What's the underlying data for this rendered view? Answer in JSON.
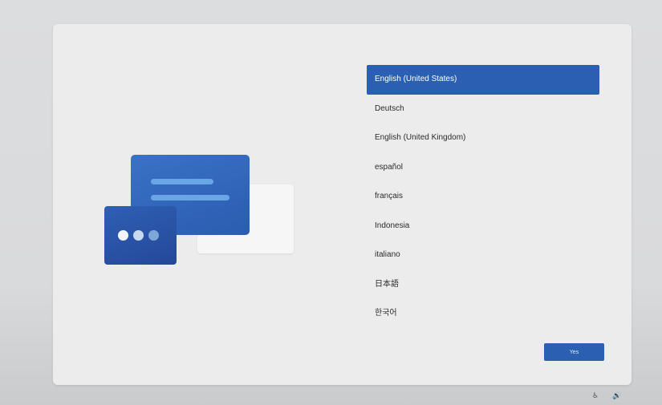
{
  "languages": [
    {
      "label": "English (United States)",
      "selected": true
    },
    {
      "label": "Deutsch",
      "selected": false
    },
    {
      "label": "English (United Kingdom)",
      "selected": false
    },
    {
      "label": "español",
      "selected": false
    },
    {
      "label": "français",
      "selected": false
    },
    {
      "label": "Indonesia",
      "selected": false
    },
    {
      "label": "italiano",
      "selected": false
    },
    {
      "label": "日本語",
      "selected": false
    },
    {
      "label": "한국어",
      "selected": false
    }
  ],
  "yes_button": {
    "label": "Yes"
  },
  "taskbar": {
    "accessibility_icon": "accessibility-icon",
    "volume_icon": "volume-icon",
    "accessibility_glyph": "♿",
    "volume_glyph": "🔊"
  },
  "colors": {
    "accent": "#2b5fb1",
    "panel": "#ececec"
  }
}
